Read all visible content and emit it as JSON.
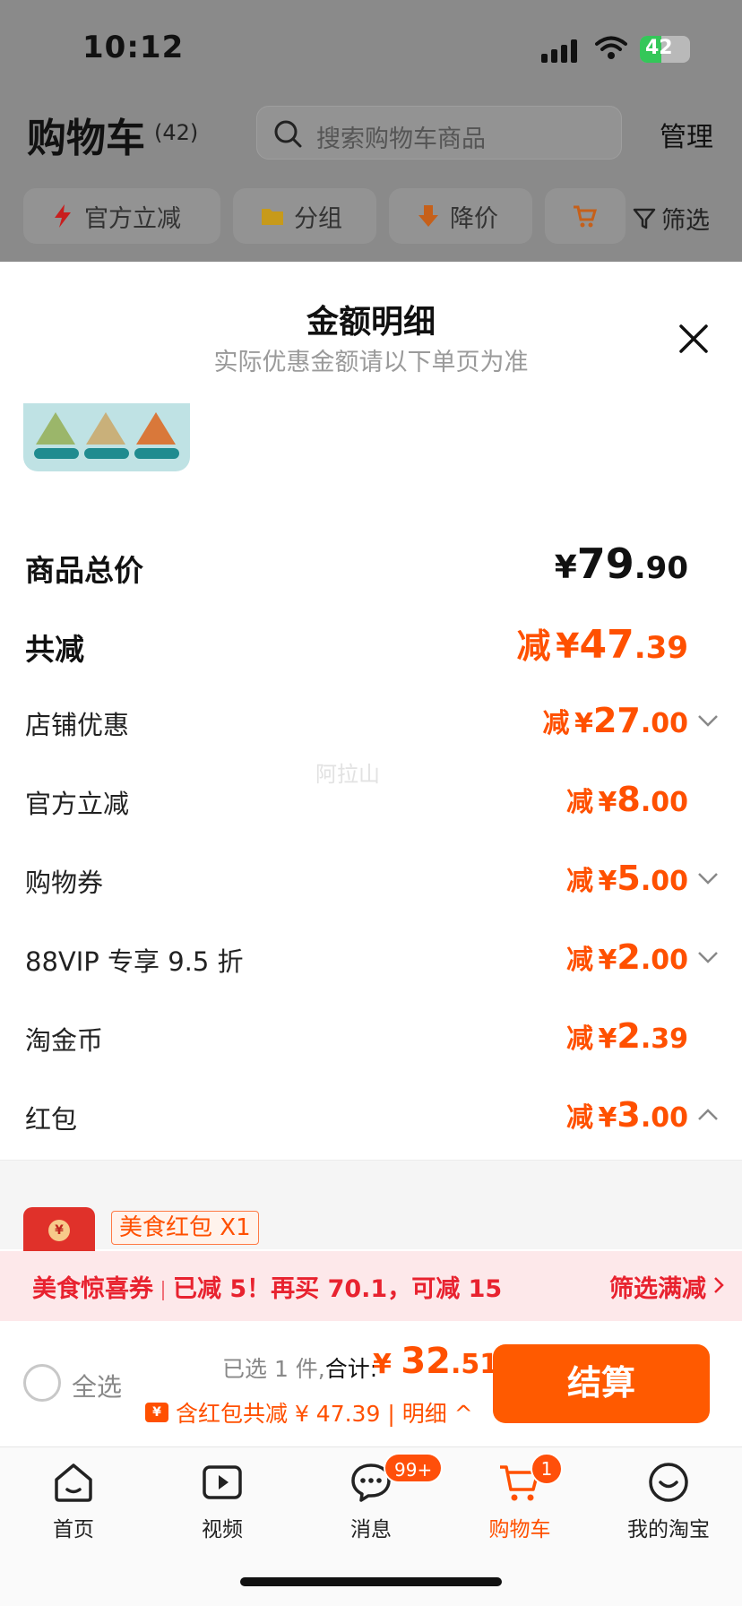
{
  "status": {
    "time": "10:12",
    "battery": "42",
    "battery_level": 0.42
  },
  "header": {
    "title": "购物车",
    "count": "(42)",
    "search_placeholder": "搜索购物车商品",
    "manage": "管理"
  },
  "chips": [
    {
      "label": "官方立减",
      "icon": "lightning-icon"
    },
    {
      "label": "分组",
      "icon": "folder-icon"
    },
    {
      "label": "降价",
      "icon": "down-arrow-icon"
    },
    {
      "label": "",
      "icon": "cart-icon"
    }
  ],
  "filter_label": "筛选",
  "sheet": {
    "title": "金额明细",
    "subtitle": "实际优惠金额请以下单页为准",
    "watermark": "阿拉山",
    "total": {
      "label": "商品总价",
      "yen": "¥",
      "int": "79",
      "dec": ".90"
    },
    "reduction": {
      "label": "共减",
      "prefix": "减",
      "yen": "¥",
      "int": "47",
      "dec": ".39"
    },
    "rows": [
      {
        "label": "店铺优惠",
        "prefix": "减",
        "yen": "¥",
        "int": "27",
        "dec": ".00",
        "chevron": "down"
      },
      {
        "label": "官方立减",
        "prefix": "减",
        "yen": "¥",
        "int": "8",
        "dec": ".00",
        "chevron": "none"
      },
      {
        "label": "购物券",
        "prefix": "减",
        "yen": "¥",
        "int": "5",
        "dec": ".00",
        "chevron": "down"
      },
      {
        "label": "88VIP 专享 9.5 折",
        "prefix": "减",
        "yen": "¥",
        "int": "2",
        "dec": ".00",
        "chevron": "down"
      },
      {
        "label": "淘金币",
        "prefix": "减",
        "yen": "¥",
        "int": "2",
        "dec": ".39",
        "chevron": "none"
      },
      {
        "label": "红包",
        "prefix": "减",
        "yen": "¥",
        "int": "3",
        "dec": ".00",
        "chevron": "up"
      }
    ],
    "redpacket_tag": "美食红包 X1",
    "redpacket_coin": "¥"
  },
  "promo": {
    "name": "美食惊喜券",
    "text": "已减 5！再买 70.1，可减 15",
    "link": "筛选满减"
  },
  "checkout": {
    "select_all": "全选",
    "selected": "已选 1 件,",
    "heji": "合计:",
    "yen": "¥ ",
    "int": "32",
    "dec": ".51",
    "badge": "¥",
    "discount": "含红包共减 ¥ 47.39",
    "detail": "| 明细 ^",
    "pay": "结算"
  },
  "tabbar": [
    {
      "label": "首页",
      "icon": "home-icon"
    },
    {
      "label": "视频",
      "icon": "video-icon"
    },
    {
      "label": "消息",
      "icon": "message-icon",
      "badge": "99+"
    },
    {
      "label": "购物车",
      "icon": "cart-icon",
      "badge": "1",
      "active": true
    },
    {
      "label": "我的淘宝",
      "icon": "profile-icon"
    }
  ],
  "colors": {
    "accent": "#ff5000",
    "promo_red": "#e8222f",
    "promo_bg": "#fde8ea"
  }
}
